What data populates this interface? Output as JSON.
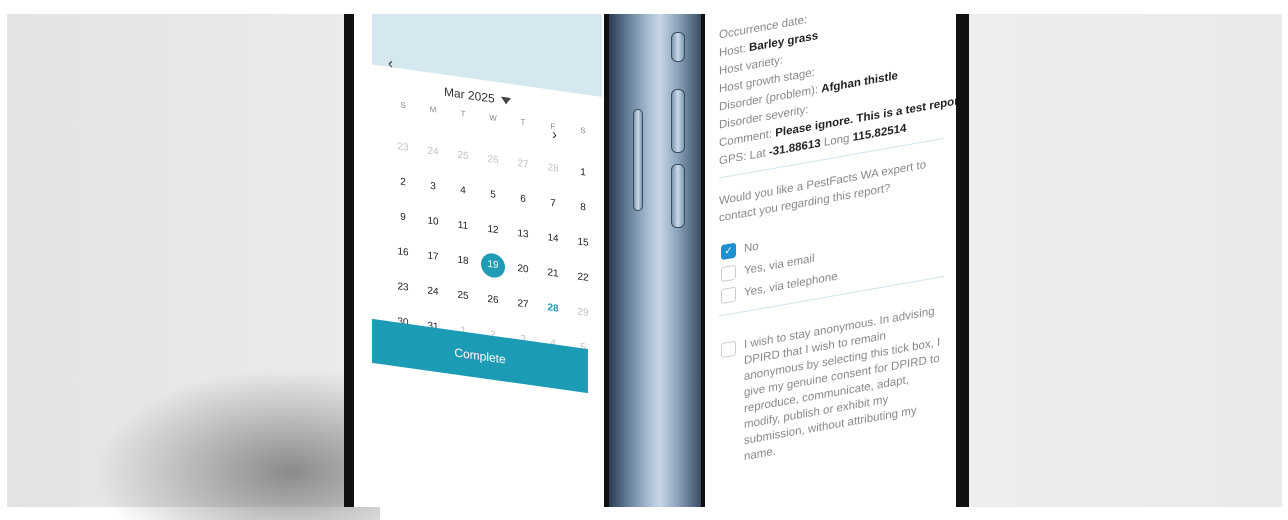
{
  "calendar": {
    "date_value": "19-03-2025",
    "month_label": "Mar 2025",
    "prev_icon": "‹",
    "next_icon": "›",
    "weekdays": [
      "S",
      "M",
      "T",
      "W",
      "T",
      "F",
      "S"
    ],
    "weeks": [
      [
        "23",
        "24",
        "25",
        "26",
        "27",
        "28",
        "1"
      ],
      [
        "2",
        "3",
        "4",
        "5",
        "6",
        "7",
        "8"
      ],
      [
        "9",
        "10",
        "11",
        "12",
        "13",
        "14",
        "15"
      ],
      [
        "16",
        "17",
        "18",
        "19",
        "20",
        "21",
        "22"
      ],
      [
        "23",
        "24",
        "25",
        "26",
        "27",
        "28",
        "29"
      ],
      [
        "30",
        "31",
        "1",
        "2",
        "3",
        "4",
        "5"
      ]
    ],
    "selected_day": "19",
    "today_day": "28",
    "complete_label": "Complete",
    "accent_color": "#1c9bb5"
  },
  "report": {
    "occurrence_label": "Occurrence date:",
    "host_label": "Host:",
    "host_value": "Barley grass",
    "host_variety_label": "Host variety:",
    "host_growth_label": "Host growth stage:",
    "disorder_label": "Disorder (problem):",
    "disorder_value": "Afghan thistle",
    "severity_label": "Disorder severity:",
    "comment_label": "Comment:",
    "comment_value": "Please ignore. This is a test report!",
    "gps_label": "GPS: Lat",
    "gps_lat": "-31.88613",
    "gps_long_label": "Long",
    "gps_long": "115.82514",
    "question": "Would you like a PestFacts WA expert to contact you regarding this report?",
    "options": [
      {
        "label": "No",
        "checked": true
      },
      {
        "label": "Yes, via email",
        "checked": false
      },
      {
        "label": "Yes, via telephone",
        "checked": false
      }
    ],
    "anonymous_text": "I wish to stay anonymous. In advising DPIRD that I wish to remain anonymous by selecting this tick box, I give my genuine consent for DPIRD to reproduce, communicate, adapt, modify, publish or exhibit my submission, without attributing my name.",
    "checkbox_color": "#1e8fd0"
  }
}
